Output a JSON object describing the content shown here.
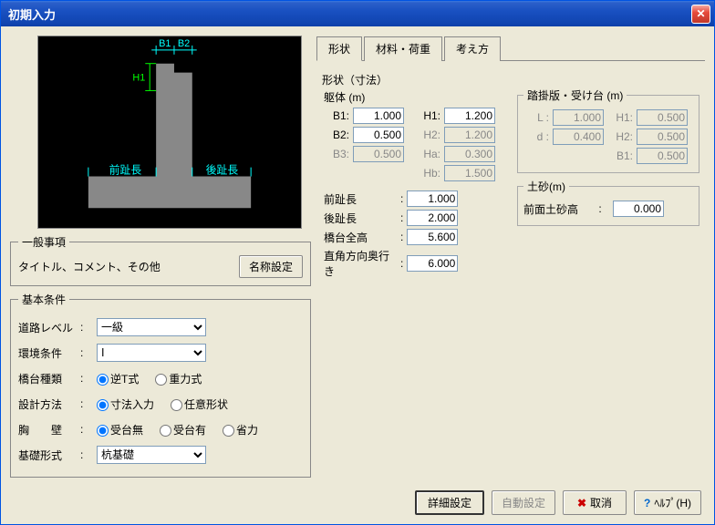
{
  "window": {
    "title": "初期入力"
  },
  "diagram": {
    "b1": "B1",
    "b2": "B2",
    "h1": "H1",
    "front": "前趾長",
    "rear": "後趾長"
  },
  "general": {
    "legend": "一般事項",
    "text": "タイトル、コメント、その他",
    "name_button": "名称設定"
  },
  "conditions": {
    "legend": "基本条件",
    "road": {
      "label": "道路レベル",
      "value": "一級"
    },
    "env": {
      "label": "環境条件",
      "value": "Ⅰ"
    },
    "type": {
      "label": "橋台種類",
      "opts": [
        "逆T式",
        "重力式"
      ]
    },
    "method": {
      "label": "設計方法",
      "opts": [
        "寸法入力",
        "任意形状"
      ]
    },
    "parapet": {
      "label": "胸　　壁",
      "opts": [
        "受台無",
        "受台有",
        "省力"
      ]
    },
    "foundation": {
      "label": "基礎形式",
      "value": "杭基礎"
    }
  },
  "tabs": [
    "形状",
    "材料・荷重",
    "考え方"
  ],
  "shape": {
    "legend": "形状（寸法）",
    "body_label": "躯体 (m)",
    "B1": {
      "label": "B1:",
      "val": "1.000"
    },
    "B2": {
      "label": "B2:",
      "val": "0.500"
    },
    "B3": {
      "label": "B3:",
      "val": "0.500"
    },
    "H1": {
      "label": "H1:",
      "val": "1.200"
    },
    "H2": {
      "label": "H2:",
      "val": "1.200"
    },
    "Ha": {
      "label": "Ha:",
      "val": "0.300"
    },
    "Hb": {
      "label": "Hb:",
      "val": "1.500"
    },
    "front_toe": {
      "label": "前趾長",
      "val": "1.000"
    },
    "rear_toe": {
      "label": "後趾長",
      "val": "2.000"
    },
    "total_h": {
      "label": "橋台全高",
      "val": "5.600"
    },
    "depth": {
      "label": "直角方向奥行き",
      "val": "6.000"
    },
    "approach": {
      "legend": "踏掛版・受け台 (m)",
      "L": {
        "label": "L :",
        "val": "1.000"
      },
      "d": {
        "label": "d :",
        "val": "0.400"
      },
      "H1": {
        "label": "H1:",
        "val": "0.500"
      },
      "H2": {
        "label": "H2:",
        "val": "0.500"
      },
      "B1": {
        "label": "B1:",
        "val": "0.500"
      }
    },
    "soil": {
      "legend": "土砂(m)",
      "front": {
        "label": "前面土砂高",
        "val": "0.000"
      }
    }
  },
  "buttons": {
    "detail": "詳細設定",
    "auto": "自動設定",
    "cancel": "取消",
    "help": "ﾍﾙﾌﾟ(H)"
  }
}
